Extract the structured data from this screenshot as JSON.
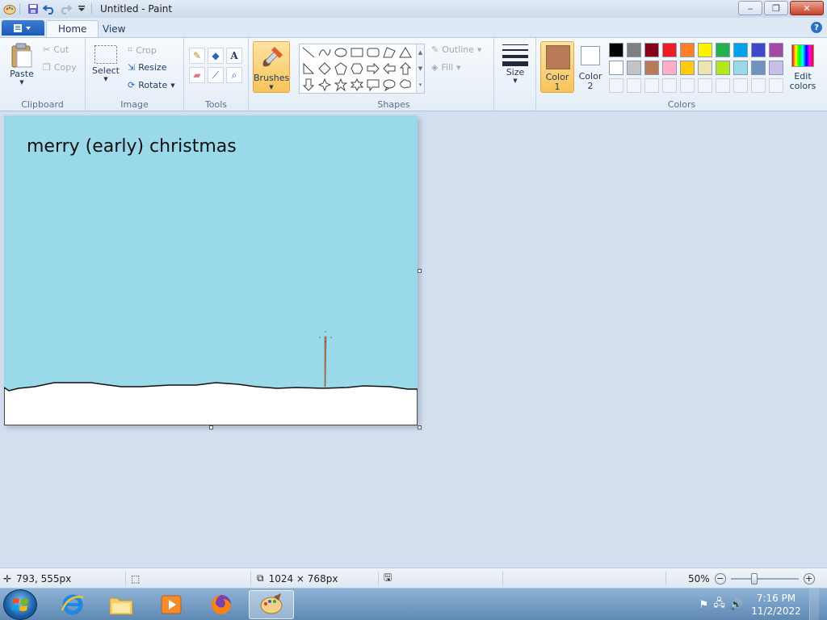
{
  "window": {
    "title": "Untitled - Paint",
    "minimize_label": "‒",
    "restore_label": "❐",
    "close_label": "✕"
  },
  "ribbon_tabs": [
    {
      "label": "Home",
      "active": true
    },
    {
      "label": "View",
      "active": false
    }
  ],
  "help_label": "?",
  "clipboard": {
    "paste": "Paste",
    "cut": "Cut",
    "copy": "Copy",
    "group": "Clipboard"
  },
  "image": {
    "select": "Select",
    "crop": "Crop",
    "resize": "Resize",
    "rotate": "Rotate",
    "group": "Image"
  },
  "tools": {
    "group": "Tools",
    "text_glyph": "A"
  },
  "brushes": {
    "label": "Brushes"
  },
  "shapes": {
    "outline": "Outline",
    "fill": "Fill",
    "group": "Shapes"
  },
  "size": {
    "label": "Size"
  },
  "colors": {
    "color1_line1": "Color",
    "color1_line2": "1",
    "color2_line1": "Color",
    "color2_line2": "2",
    "edit_line1": "Edit",
    "edit_line2": "colors",
    "group": "Colors",
    "color1_value": "#b97a57",
    "color2_value": "#ffffff",
    "palette_row1": [
      "#000000",
      "#7f7f7f",
      "#880015",
      "#ed1c24",
      "#ff7f27",
      "#fff200",
      "#22b14c",
      "#00a2e8",
      "#3f48cc",
      "#a349a4"
    ],
    "palette_row2": [
      "#ffffff",
      "#c3c3c3",
      "#b97a57",
      "#ffaec9",
      "#ffc90e",
      "#efe4b0",
      "#b5e61d",
      "#99d9ea",
      "#7092be",
      "#c8bfe7"
    ]
  },
  "canvas": {
    "text": "merry (early) christmas",
    "sky_color": "#99d9ea",
    "snow_color": "#ffffff"
  },
  "status": {
    "cursor_position": "793, 555px",
    "selection_size": "",
    "image_size": "1024 × 768px",
    "zoom": "50%"
  },
  "taskbar": {
    "time": "7:16 PM",
    "date": "11/2/2022"
  }
}
